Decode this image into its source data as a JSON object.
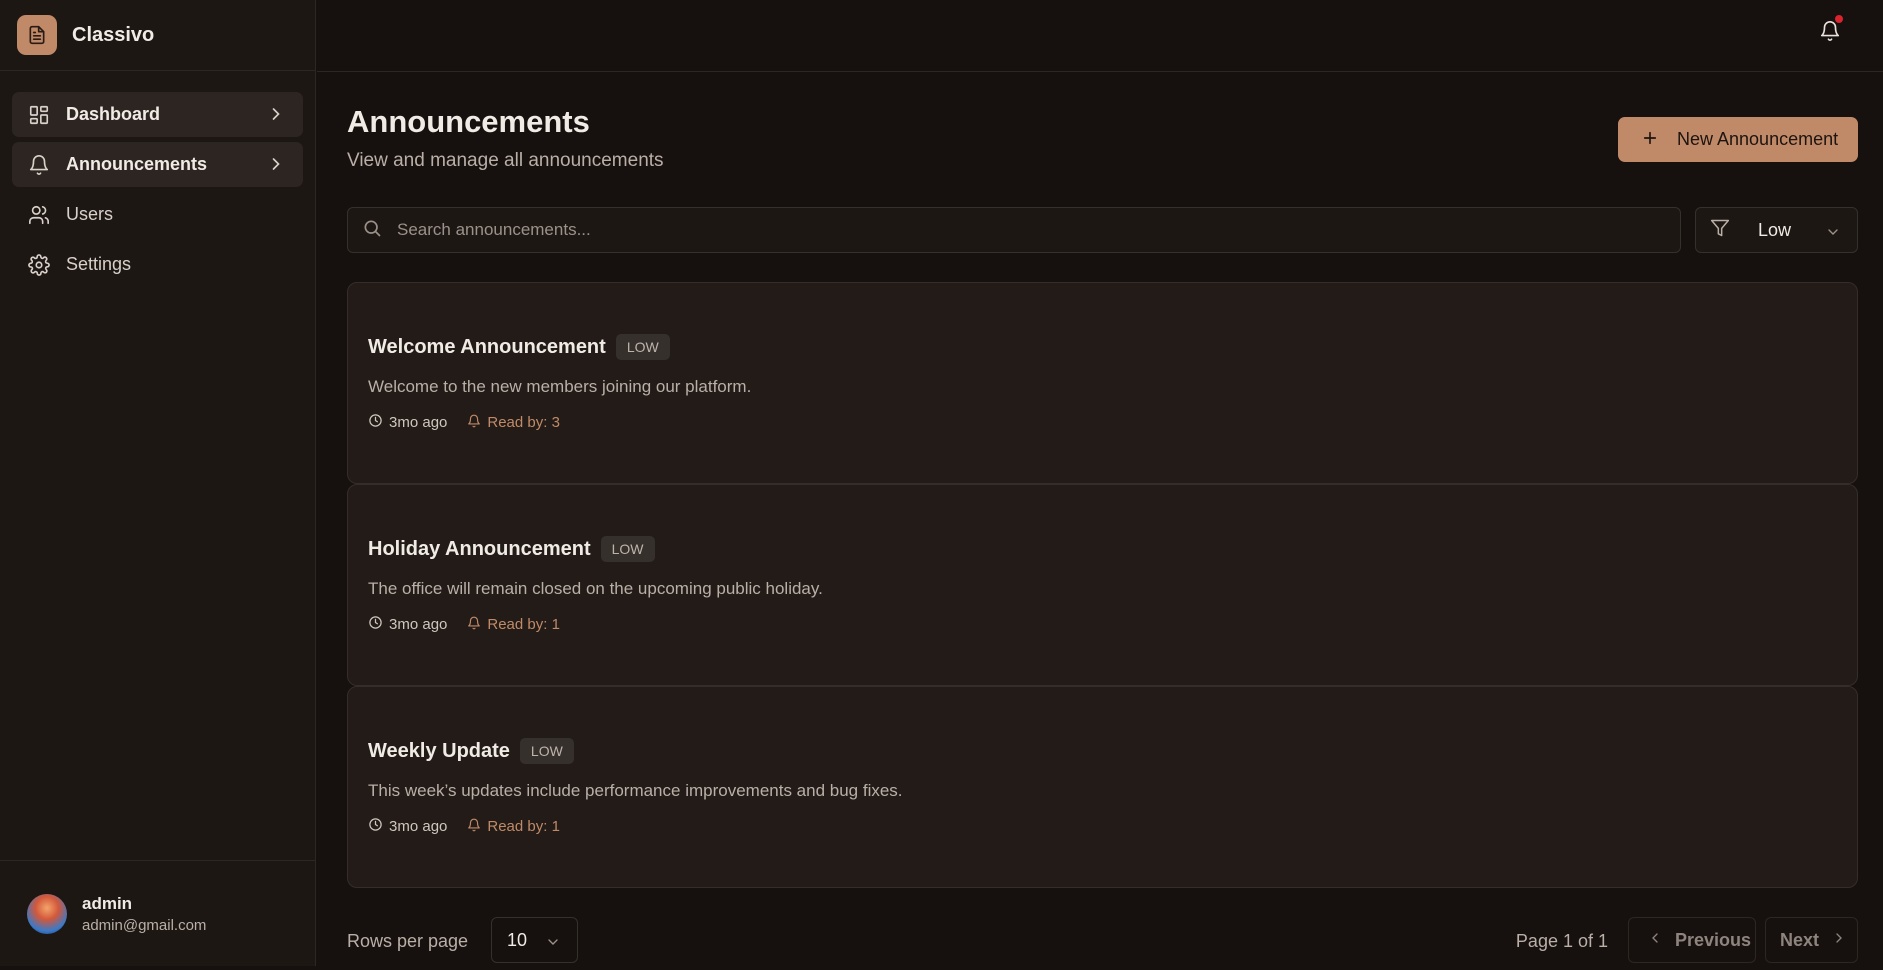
{
  "app": {
    "name": "Classivo"
  },
  "sidebar": {
    "items": [
      {
        "label": "Dashboard",
        "icon": "layout-grid-icon",
        "active": true
      },
      {
        "label": "Announcements",
        "icon": "bell-icon",
        "active": true
      },
      {
        "label": "Users",
        "icon": "users-icon",
        "active": false
      },
      {
        "label": "Settings",
        "icon": "gear-icon",
        "active": false
      }
    ],
    "user": {
      "name": "admin",
      "email": "admin@gmail.com"
    }
  },
  "header": {
    "notification_dot": true
  },
  "page": {
    "title": "Announcements",
    "subtitle": "View and manage all announcements",
    "new_button": "New Announcement"
  },
  "search": {
    "placeholder": "Search announcements...",
    "value": ""
  },
  "filter": {
    "value": "Low"
  },
  "announcements": [
    {
      "title": "Welcome Announcement",
      "priority": "LOW",
      "description": "Welcome to the new members joining our platform.",
      "time": "3mo ago",
      "read": "Read by: 3"
    },
    {
      "title": "Holiday Announcement",
      "priority": "LOW",
      "description": "The office will remain closed on the upcoming public holiday.",
      "time": "3mo ago",
      "read": "Read by: 1"
    },
    {
      "title": "Weekly Update",
      "priority": "LOW",
      "description": "This week’s updates include performance improvements and bug fixes.",
      "time": "3mo ago",
      "read": "Read by: 1"
    }
  ],
  "pagination": {
    "rows_label": "Rows per page",
    "rows_value": "10",
    "page_info": "Page 1 of 1",
    "previous": "Previous",
    "next": "Next"
  },
  "colors": {
    "accent": "#c08a68",
    "background": "#16100e",
    "card": "#221b17",
    "notification": "#d8242c"
  }
}
